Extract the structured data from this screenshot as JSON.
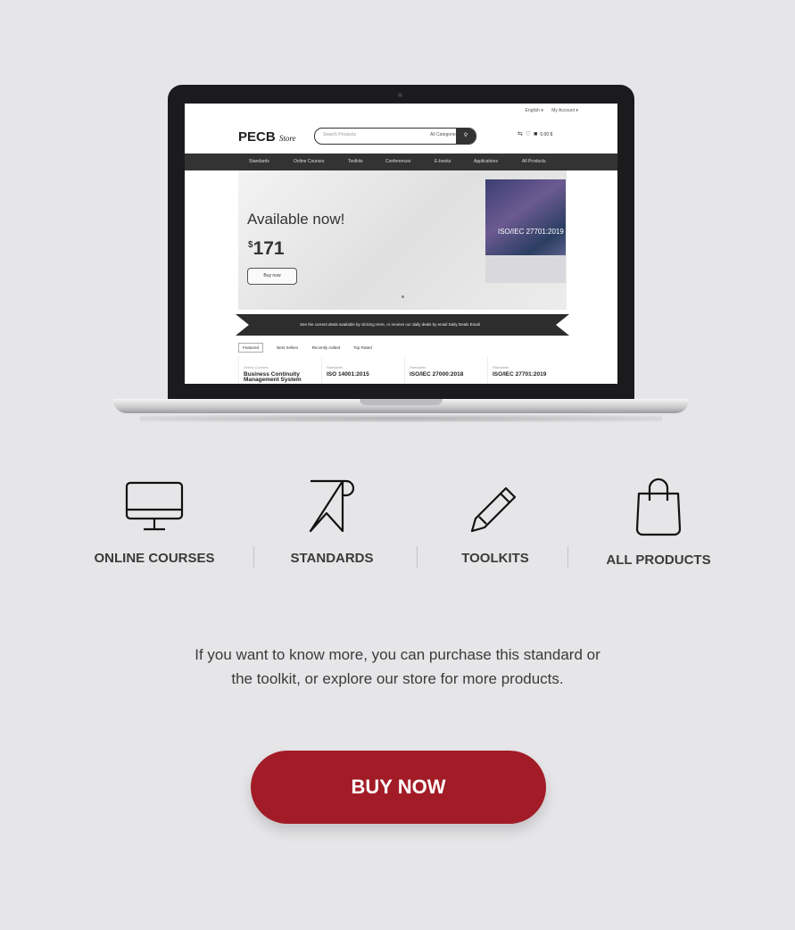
{
  "screenshot": {
    "top_links": [
      "English ▾",
      "My Account ▾"
    ],
    "logo": "PECB",
    "logo_suffix": "Store",
    "search_placeholder": "Search Products",
    "search_category": "All Categories",
    "cart_amount": "0.00 $",
    "menu": [
      "Standards",
      "Online Courses",
      "Toolkits",
      "Conferences",
      "E-books",
      "Applications",
      "All Products"
    ],
    "hero_title": "Available now!",
    "hero_currency": "$",
    "hero_price": "171",
    "hero_button": "Buy now",
    "product_box_title": "ISO/IEC 27701:2019",
    "banner_text": "See the current deals available by clicking Here, or receive our daily deals by email Daily Deals Email",
    "tabs": [
      "Featured",
      "Best Sellers",
      "Recently Added",
      "Top Rated"
    ],
    "products": [
      {
        "category": "Online Courses",
        "name": "Business Continuity Management System"
      },
      {
        "category": "Standards",
        "name": "ISO 14001:2015"
      },
      {
        "category": "Standards",
        "name": "ISO/IEC 27000:2018"
      },
      {
        "category": "Standards",
        "name": "ISO/IEC 27701:2019"
      }
    ]
  },
  "categories": [
    {
      "label": "ONLINE COURSES",
      "icon": "monitor-icon"
    },
    {
      "label": "STANDARDS",
      "icon": "bookmark-icon"
    },
    {
      "label": "TOOLKITS",
      "icon": "pencil-icon"
    },
    {
      "label": "ALL PRODUCTS",
      "icon": "shopping-bag-icon"
    }
  ],
  "description_line1": "If you want to know more, you can purchase this standard or",
  "description_line2": "the toolkit, or explore our store for more products.",
  "buy_button": "BUY NOW",
  "colors": {
    "accent": "#a21c27",
    "background": "#e6e6e8",
    "text": "#3b3b3b"
  }
}
